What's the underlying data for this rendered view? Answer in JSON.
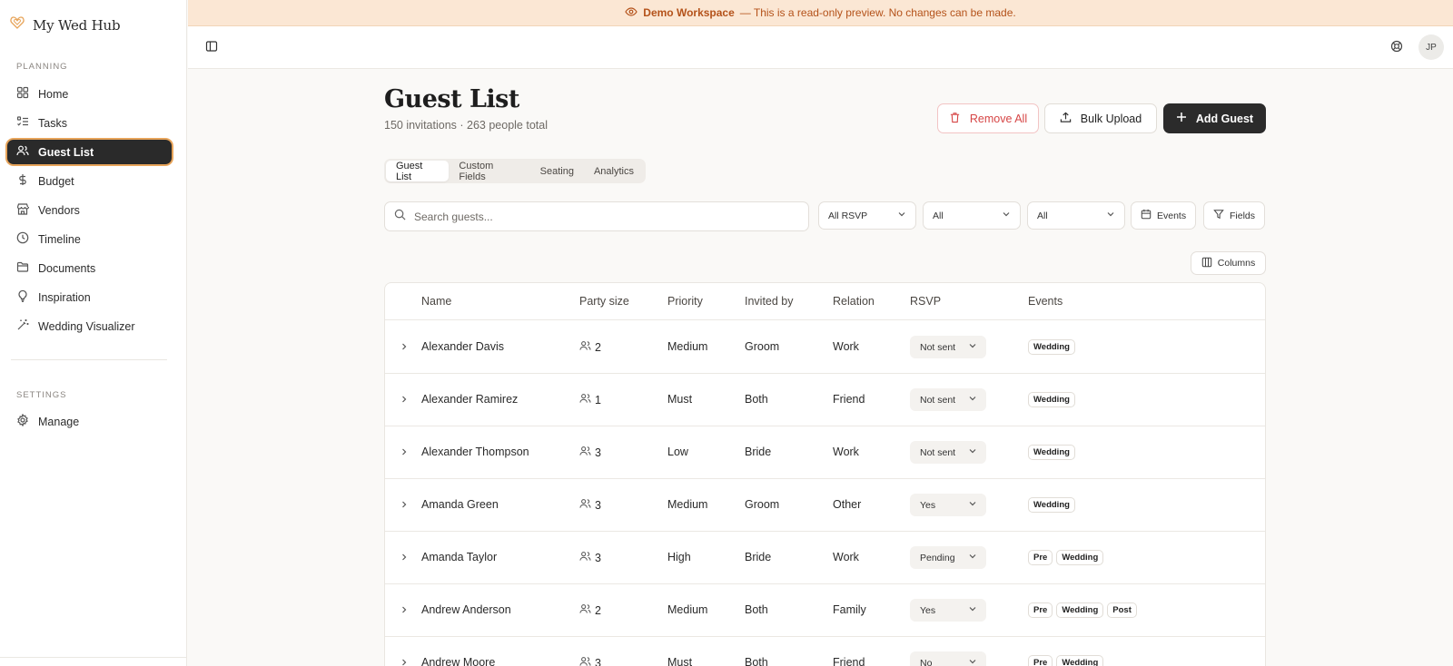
{
  "brand": {
    "name": "My Wed Hub"
  },
  "sidebar": {
    "planning_label": "PLANNING",
    "settings_label": "SETTINGS",
    "items": [
      {
        "label": "Home",
        "icon": "grid-icon"
      },
      {
        "label": "Tasks",
        "icon": "checklist-icon"
      },
      {
        "label": "Guest List",
        "icon": "users-icon",
        "active": true
      },
      {
        "label": "Budget",
        "icon": "dollar-icon"
      },
      {
        "label": "Vendors",
        "icon": "store-icon"
      },
      {
        "label": "Timeline",
        "icon": "clock-icon"
      },
      {
        "label": "Documents",
        "icon": "folder-icon"
      },
      {
        "label": "Inspiration",
        "icon": "lightbulb-icon"
      },
      {
        "label": "Wedding Visualizer",
        "icon": "magic-wand-icon"
      }
    ],
    "settings_items": [
      {
        "label": "Manage",
        "icon": "gear-icon"
      }
    ]
  },
  "banner": {
    "workspace": "Demo Workspace",
    "message": "— This is a read-only preview. No changes can be made.",
    "color": "#b4521a"
  },
  "topbar": {
    "avatar_initials": "JP"
  },
  "page": {
    "title": "Guest List",
    "subtitle": "150 invitations · 263 people total"
  },
  "actions": {
    "remove_all": "Remove All",
    "bulk_upload": "Bulk Upload",
    "add_guest": "Add Guest"
  },
  "tabs": [
    "Guest List",
    "Custom Fields",
    "Seating",
    "Analytics"
  ],
  "filters": {
    "search_placeholder": "Search guests...",
    "rsvp": "All RSVP",
    "filter2": "All",
    "filter3": "All",
    "events": "Events",
    "fields": "Fields",
    "columns": "Columns"
  },
  "table": {
    "headers": [
      "Name",
      "Party size",
      "Priority",
      "Invited by",
      "Relation",
      "RSVP",
      "Events"
    ],
    "rows": [
      {
        "name": "Alexander Davis",
        "party": "2",
        "priority": "Medium",
        "invited_by": "Groom",
        "relation": "Work",
        "rsvp": "Not sent",
        "events": [
          "Wedding"
        ]
      },
      {
        "name": "Alexander Ramirez",
        "party": "1",
        "priority": "Must",
        "invited_by": "Both",
        "relation": "Friend",
        "rsvp": "Not sent",
        "events": [
          "Wedding"
        ]
      },
      {
        "name": "Alexander Thompson",
        "party": "3",
        "priority": "Low",
        "invited_by": "Bride",
        "relation": "Work",
        "rsvp": "Not sent",
        "events": [
          "Wedding"
        ]
      },
      {
        "name": "Amanda Green",
        "party": "3",
        "priority": "Medium",
        "invited_by": "Groom",
        "relation": "Other",
        "rsvp": "Yes",
        "events": [
          "Wedding"
        ]
      },
      {
        "name": "Amanda Taylor",
        "party": "3",
        "priority": "High",
        "invited_by": "Bride",
        "relation": "Work",
        "rsvp": "Pending",
        "events": [
          "Pre",
          "Wedding"
        ]
      },
      {
        "name": "Andrew Anderson",
        "party": "2",
        "priority": "Medium",
        "invited_by": "Both",
        "relation": "Family",
        "rsvp": "Yes",
        "events": [
          "Pre",
          "Wedding",
          "Post"
        ]
      },
      {
        "name": "Andrew Moore",
        "party": "3",
        "priority": "Must",
        "invited_by": "Both",
        "relation": "Friend",
        "rsvp": "No",
        "events": [
          "Pre",
          "Wedding"
        ]
      }
    ]
  }
}
